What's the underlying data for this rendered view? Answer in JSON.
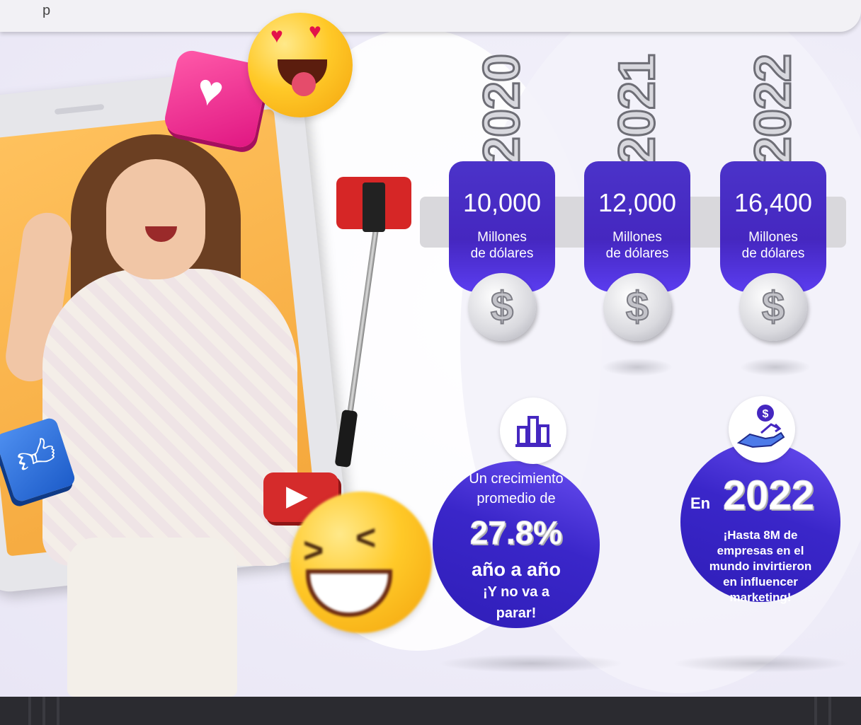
{
  "header": {
    "text": "p"
  },
  "timeline": [
    {
      "year": "2020",
      "amount": "10,000",
      "unit_line1": "Millones",
      "unit_line2": "de dólares",
      "coin_symbol": "$"
    },
    {
      "year": "2021",
      "amount": "12,000",
      "unit_line1": "Millones",
      "unit_line2": "de dólares",
      "coin_symbol": "$"
    },
    {
      "year": "2022",
      "amount": "16,400",
      "unit_line1": "Millones",
      "unit_line2": "de dólares",
      "coin_symbol": "$"
    }
  ],
  "stats": {
    "growth": {
      "line1": "Un crecimiento",
      "line2": "promedio de",
      "percent": "27.8%",
      "line3": "año a año",
      "line4": "¡Y no va a",
      "line5": "parar!",
      "icon": "bar-chart-icon"
    },
    "companies": {
      "prefix": "En",
      "year": "2022",
      "line1": "¡Hasta 8M de",
      "line2": "empresas en el",
      "line3": "mundo invirtieron",
      "line4": "en influencer",
      "line5": "marketing!",
      "icon": "hand-coin-growth-icon"
    }
  },
  "icons": {
    "heart": "heart-icon",
    "facebook_like": "thumbs-up-icon",
    "youtube": "play-icon",
    "emoji_love": "heart-eyes-emoji",
    "emoji_laugh": "laughing-emoji"
  },
  "colors": {
    "accent_purple": "#4527c0",
    "accent_gradient_end": "#6a4ff3",
    "heart_pink": "#e01682",
    "facebook_blue": "#1d5cc9",
    "youtube_red": "#d52b2b"
  }
}
